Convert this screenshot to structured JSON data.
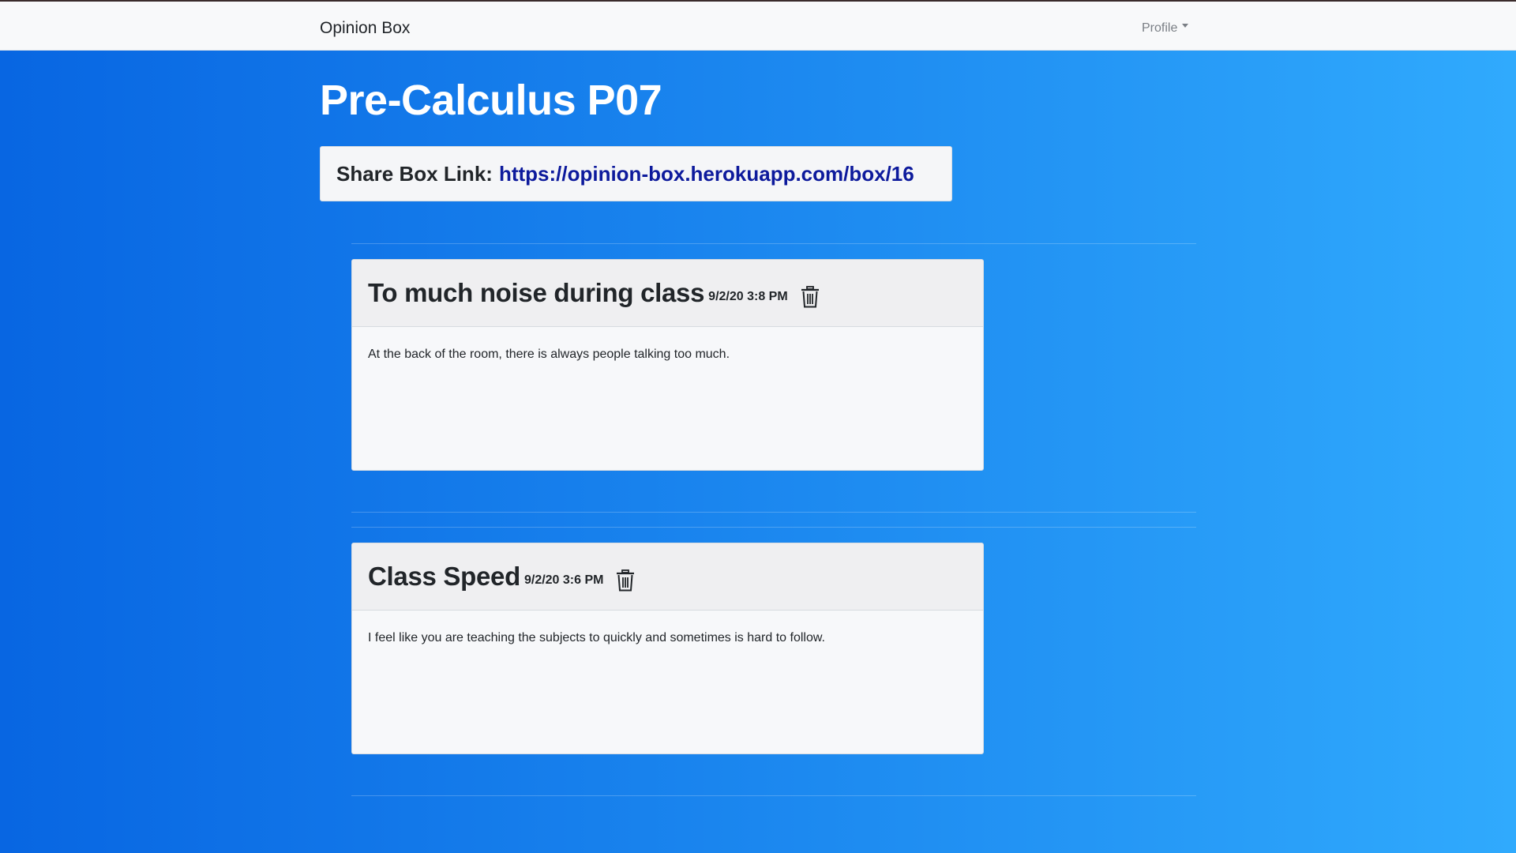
{
  "navbar": {
    "brand": "Opinion Box",
    "profile": "Profile"
  },
  "page": {
    "title": "Pre-Calculus P07"
  },
  "share": {
    "label": "Share Box Link:",
    "link": "https://opinion-box.herokuapp.com/box/16"
  },
  "opinions": [
    {
      "title": "To much noise during class",
      "time": "9/2/20 3:8 PM",
      "body": "At the back of the room, there is always people talking too much.",
      "delete_icon": "trash-icon"
    },
    {
      "title": "Class Speed",
      "time": "9/2/20 3:6 PM",
      "body": "I feel like you are teaching the subjects to quickly and sometimes is hard to follow.",
      "delete_icon": "trash-icon"
    }
  ],
  "colors": {
    "background_left": "#0866e2",
    "background_right": "#30aafd",
    "link": "#0d1a9c",
    "navbar": "#f8f9fa"
  }
}
